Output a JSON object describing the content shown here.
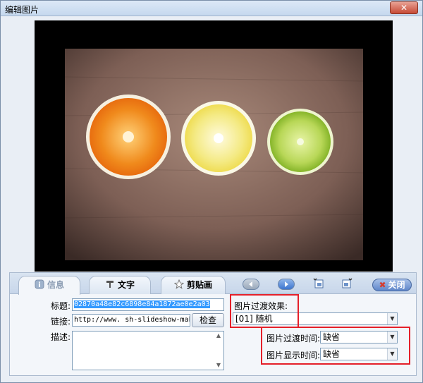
{
  "window": {
    "title": "编辑图片",
    "close_label": "✕"
  },
  "tabs": [
    {
      "label": "信息",
      "icon": "info-icon"
    },
    {
      "label": "文字",
      "icon": "text-icon"
    },
    {
      "label": "剪贴画",
      "icon": "star-icon"
    }
  ],
  "toolbar": {
    "close_label": "关闭",
    "close_icon": "x-icon"
  },
  "form": {
    "title_label": "标题:",
    "title_value": "02870a48e82c6898e84a1872ae0e2a03",
    "link_label": "链接:",
    "link_value": "http://www.   sh-slideshow-maker.",
    "check_label": "检查",
    "desc_label": "描述:",
    "desc_value": ""
  },
  "transition": {
    "effect_label": "图片过渡效果:",
    "effect_value": "[01] 随机",
    "duration_label": "图片过渡时间:",
    "duration_value": "缺省",
    "display_label": "图片显示时间:",
    "display_value": "缺省"
  },
  "colors": {
    "highlight": "#e5202a",
    "selection": "#3399ff"
  }
}
